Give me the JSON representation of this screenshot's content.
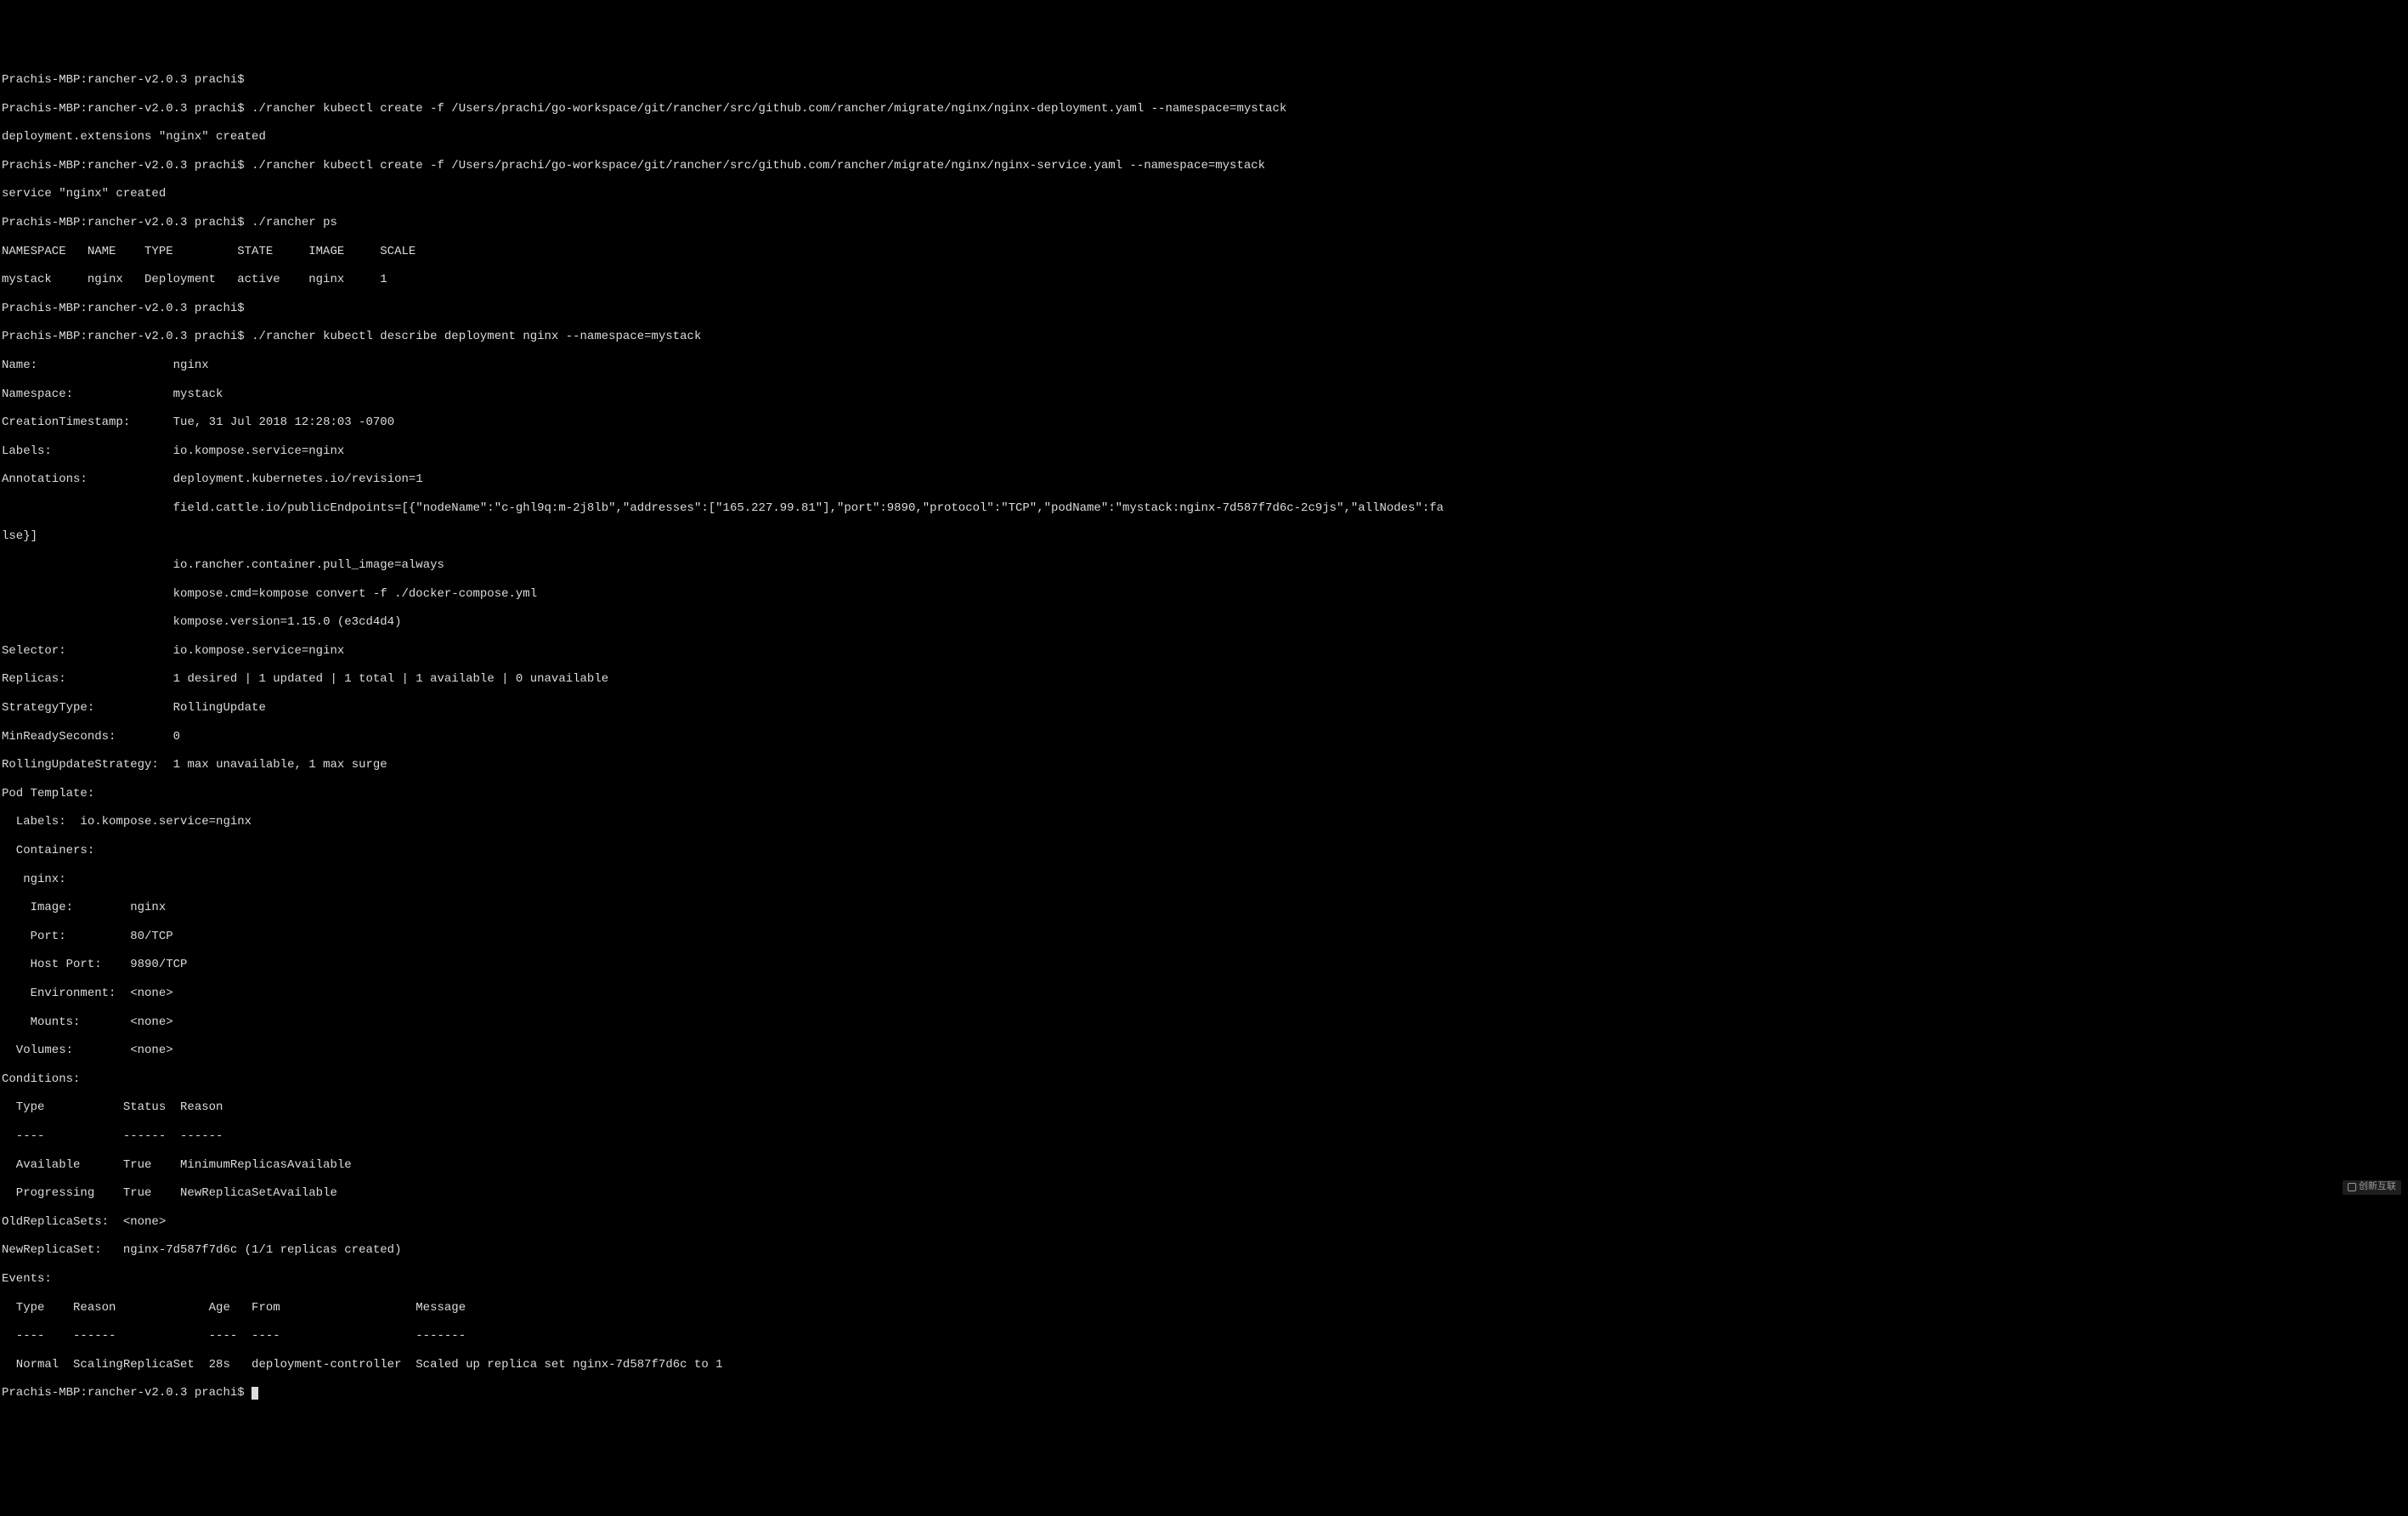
{
  "prompt": "Prachis-MBP:rancher-v2.0.3 prachi$",
  "commands": {
    "cmd1": "./rancher kubectl create -f /Users/prachi/go-workspace/git/rancher/src/github.com/rancher/migrate/nginx/nginx-deployment.yaml --namespace=mystack",
    "cmd1_output": "deployment.extensions \"nginx\" created",
    "cmd2": "./rancher kubectl create -f /Users/prachi/go-workspace/git/rancher/src/github.com/rancher/migrate/nginx/nginx-service.yaml --namespace=mystack",
    "cmd2_output": "service \"nginx\" created",
    "cmd3": "./rancher ps",
    "cmd4": "./rancher kubectl describe deployment nginx --namespace=mystack"
  },
  "ps_output": {
    "header": "NAMESPACE   NAME    TYPE         STATE     IMAGE     SCALE",
    "row1": "mystack     nginx   Deployment   active    nginx     1"
  },
  "describe": {
    "name_label": "Name:",
    "name_value": "nginx",
    "namespace_label": "Namespace:",
    "namespace_value": "mystack",
    "creation_label": "CreationTimestamp:",
    "creation_value": "Tue, 31 Jul 2018 12:28:03 -0700",
    "labels_label": "Labels:",
    "labels_value": "io.kompose.service=nginx",
    "annotations_label": "Annotations:",
    "annotations_value1": "deployment.kubernetes.io/revision=1",
    "annotations_value2": "field.cattle.io/publicEndpoints=[{\"nodeName\":\"c-ghl9q:m-2j8lb\",\"addresses\":[\"165.227.99.81\"],\"port\":9890,\"protocol\":\"TCP\",\"podName\":\"mystack:nginx-7d587f7d6c-2c9js\",\"allNodes\":fa",
    "annotations_cont": "lse}]",
    "annotations_value3": "io.rancher.container.pull_image=always",
    "annotations_value4": "kompose.cmd=kompose convert -f ./docker-compose.yml",
    "annotations_value5": "kompose.version=1.15.0 (e3cd4d4)",
    "selector_label": "Selector:",
    "selector_value": "io.kompose.service=nginx",
    "replicas_label": "Replicas:",
    "replicas_value": "1 desired | 1 updated | 1 total | 1 available | 0 unavailable",
    "strategy_label": "StrategyType:",
    "strategy_value": "RollingUpdate",
    "minready_label": "MinReadySeconds:",
    "minready_value": "0",
    "rolling_label": "RollingUpdateStrategy:",
    "rolling_value": "1 max unavailable, 1 max surge",
    "pod_template": "Pod Template:",
    "pod_labels": "  Labels:  io.kompose.service=nginx",
    "containers": "  Containers:",
    "nginx_container": "   nginx:",
    "image_line": "    Image:        nginx",
    "port_line": "    Port:         80/TCP",
    "hostport_line": "    Host Port:    9890/TCP",
    "env_line": "    Environment:  <none>",
    "mounts_line": "    Mounts:       <none>",
    "volumes_line": "  Volumes:        <none>",
    "conditions": "Conditions:",
    "cond_header": "  Type           Status  Reason",
    "cond_divider": "  ----           ------  ------",
    "cond_available": "  Available      True    MinimumReplicasAvailable",
    "cond_progressing": "  Progressing    True    NewReplicaSetAvailable",
    "old_rs": "OldReplicaSets:  <none>",
    "new_rs": "NewReplicaSet:   nginx-7d587f7d6c (1/1 replicas created)",
    "events": "Events:",
    "events_header": "  Type    Reason             Age   From                   Message",
    "events_divider": "  ----    ------             ----  ----                   -------",
    "events_row": "  Normal  ScalingReplicaSet  28s   deployment-controller  Scaled up replica set nginx-7d587f7d6c to 1"
  },
  "watermark": "创新互联"
}
